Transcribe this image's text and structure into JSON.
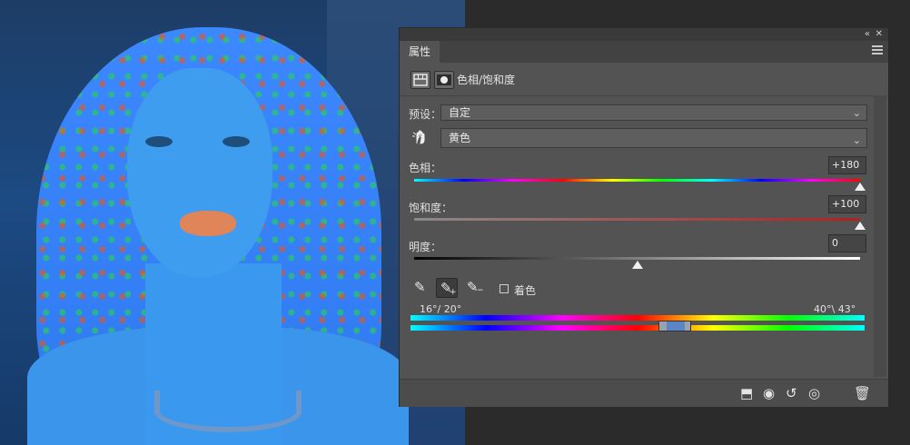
{
  "panel": {
    "tab": "属性",
    "title": "色相/饱和度",
    "collapse_glyph": "«",
    "close_glyph": "✕",
    "preset": {
      "label": "预设：",
      "value": "自定"
    },
    "channel": {
      "value": "黄色",
      "hand_icon": "target-adjust-icon"
    },
    "hue": {
      "label": "色相：",
      "value": "+180",
      "level": 1.0
    },
    "saturation": {
      "label": "饱和度：",
      "value": "+100",
      "level": 1.0
    },
    "lightness": {
      "label": "明度：",
      "value": "0",
      "level": 0.5
    },
    "colorize": {
      "label": "着色",
      "checked": false
    },
    "range": {
      "left": "16°/ 20°",
      "right": "40°\\ 43°"
    },
    "eyedroppers": [
      "eyedropper-icon",
      "eyedropper-add-icon",
      "eyedropper-subtract-icon"
    ]
  },
  "colors": {
    "panel_bg": "#535353",
    "photo_tint": "#3c88ff"
  }
}
